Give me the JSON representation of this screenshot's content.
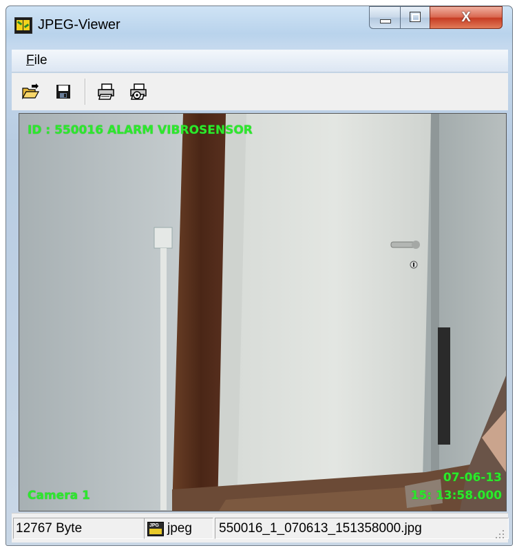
{
  "window": {
    "title": "JPEG-Viewer",
    "close_symbol": "X"
  },
  "menu": {
    "file_label_rest": "ile",
    "file_label_mnemonic": "F"
  },
  "toolbar": {
    "buttons": [
      {
        "name": "open",
        "icon": "folder-open-icon"
      },
      {
        "name": "save",
        "icon": "floppy-disk-icon"
      },
      {
        "name": "print",
        "icon": "printer-icon"
      },
      {
        "name": "print-setup",
        "icon": "printer-setup-icon"
      }
    ]
  },
  "image": {
    "overlay_top": "ID : 550016  ALARM VIBROSENSOR",
    "overlay_camera": "Camera 1",
    "overlay_date": "07-06-13",
    "overlay_time": "15: 13:58.000",
    "overlay_color": "#2de82d"
  },
  "status": {
    "size": "12767 Byte",
    "format": "jpeg",
    "filename": "550016_1_070613_151358000.jpg"
  },
  "colors": {
    "menubar": "#dce6f3",
    "toolbar": "#f0f0f0",
    "close_button": "#c63a22"
  }
}
